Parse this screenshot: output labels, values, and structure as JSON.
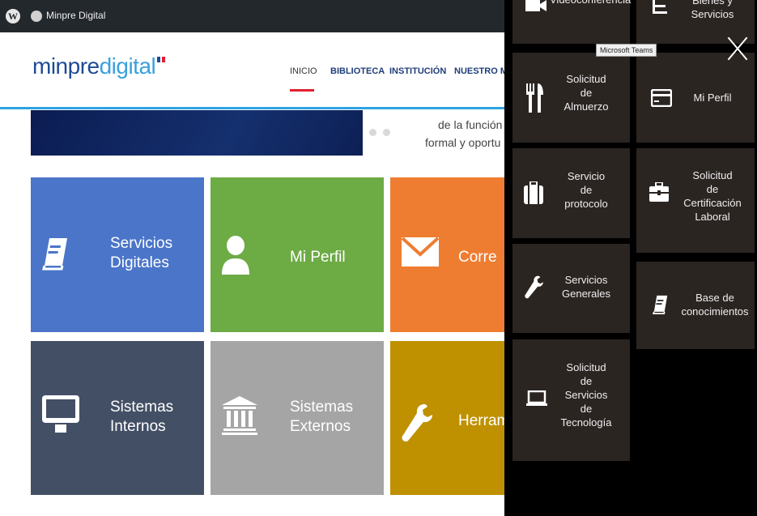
{
  "admin_bar": {
    "site_name": "Minpre Digital"
  },
  "header": {
    "logo_part1": "minpre",
    "logo_part2": "digital",
    "nav": [
      "INICIO",
      "BIBLIOTECA",
      "INSTITUCIÓN",
      "NUESTRO MIN"
    ]
  },
  "hero": {
    "text_line1": "de la función",
    "text_line2": "formal y oportu"
  },
  "tiles": [
    {
      "line1": "Servicios",
      "line2": "Digitales",
      "color": "#4a75c9"
    },
    {
      "line1": "Mi Perfil",
      "color": "#6dab45"
    },
    {
      "line1": "Corre",
      "color": "#ee7d31"
    },
    {
      "line1": "Sistemas",
      "line2": "Internos",
      "color": "#434f65"
    },
    {
      "line1": "Sistemas",
      "line2": "Externos",
      "color": "#a5a5a5"
    },
    {
      "line1": "Herrami",
      "color": "#bf9000"
    }
  ],
  "overlay": {
    "top_left_label": "Videoconferencia",
    "top_right_label": [
      "Bienes y",
      "Servicios"
    ],
    "tooltip": "Microsoft Teams",
    "tiles": [
      {
        "lines": [
          "Solicitud",
          "de",
          "Almuerzo"
        ]
      },
      {
        "lines": [
          "Mi Perfil"
        ]
      },
      {
        "lines": [
          "Servicio",
          "de",
          "protocolo"
        ]
      },
      {
        "lines": [
          "Solicitud",
          "de",
          "Certificación",
          "Laboral"
        ]
      },
      {
        "lines": [
          "Servicios",
          "Generales"
        ]
      },
      {
        "lines": [
          "Base de",
          "conocimientos"
        ]
      },
      {
        "lines": [
          "Solicitud",
          "de",
          "Servicios",
          "de",
          "Tecnología"
        ]
      }
    ]
  },
  "icons": {
    "wp": "wordpress-icon",
    "site": "site-icon",
    "close": "close-icon"
  }
}
